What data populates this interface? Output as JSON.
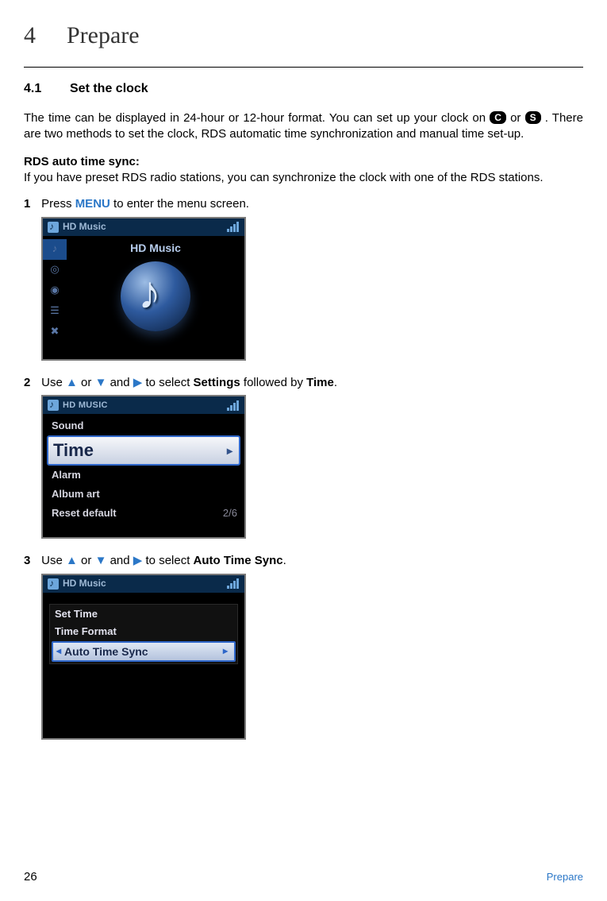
{
  "chapter": {
    "number": "4",
    "title": "Prepare"
  },
  "section": {
    "number": "4.1",
    "title": "Set the clock"
  },
  "intro_pre": "The time can be displayed in 24-hour or 12-hour format. You can set up your clock on ",
  "intro_mid": " or ",
  "intro_post": " . There are two methods to set the clock, RDS automatic time synchronization and manual time set-up.",
  "key_badge1": "C",
  "key_badge2": "S",
  "rds_heading": "RDS auto time sync:",
  "rds_body": "If you have preset RDS radio stations, you can synchronize the clock with one of the RDS stations.",
  "steps": {
    "s1": {
      "num": "1",
      "pre": "Press ",
      "key": "MENU",
      "post": " to enter the menu screen."
    },
    "s2": {
      "num": "2",
      "pre": "Use ",
      "mid1": " or ",
      "mid2": " and ",
      "mid3": " to select ",
      "bold1": "Settings",
      "mid4": " followed by ",
      "bold2": "Time",
      "post": "."
    },
    "s3": {
      "num": "3",
      "pre": "Use ",
      "mid1": " or ",
      "mid2": " and ",
      "mid3": " to select ",
      "bold1": "Auto Time Sync",
      "post": "."
    }
  },
  "screens": {
    "sc1": {
      "topbar": "HD Music",
      "main_title": "HD Music"
    },
    "sc2": {
      "topbar": "HD MUSIC",
      "items": [
        "Sound",
        "Time",
        "Alarm",
        "Album art",
        "Reset default"
      ],
      "count": "2/6"
    },
    "sc3": {
      "topbar": "HD Music",
      "items": [
        "Set Time",
        "Time Format",
        "Auto Time Sync"
      ]
    }
  },
  "footer": {
    "page": "26",
    "label": "Prepare"
  }
}
